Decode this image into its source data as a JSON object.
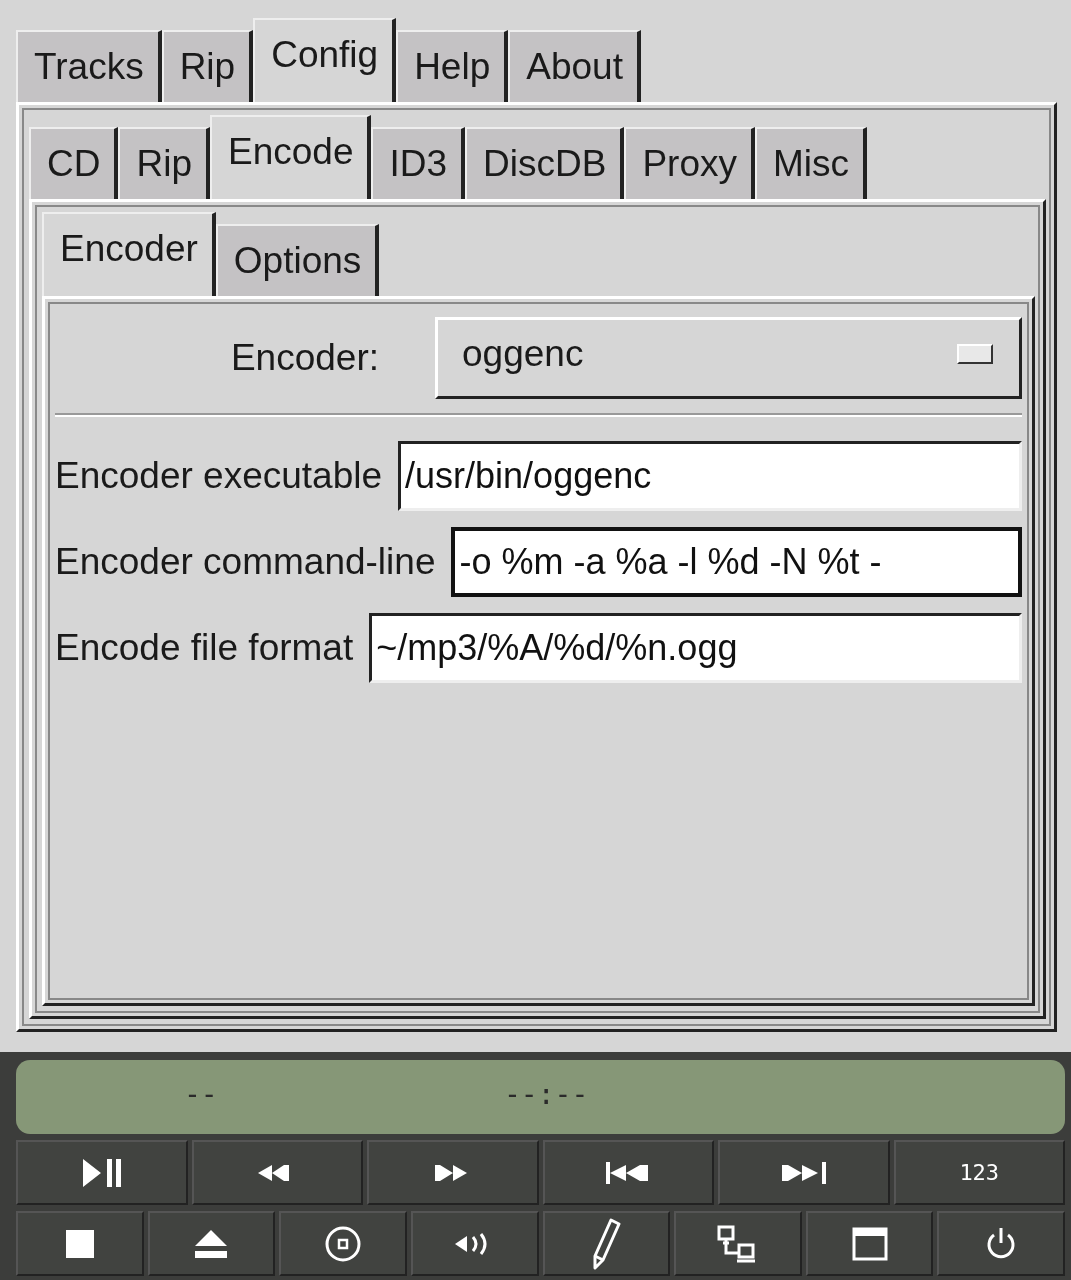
{
  "tabs": [
    {
      "label": "Tracks",
      "selected": false
    },
    {
      "label": "Rip",
      "selected": false
    },
    {
      "label": "Config",
      "selected": true
    },
    {
      "label": "Help",
      "selected": false
    },
    {
      "label": "About",
      "selected": false
    }
  ],
  "config_tabs": [
    {
      "label": "CD",
      "selected": false
    },
    {
      "label": "Rip",
      "selected": false
    },
    {
      "label": "Encode",
      "selected": true
    },
    {
      "label": "ID3",
      "selected": false
    },
    {
      "label": "DiscDB",
      "selected": false
    },
    {
      "label": "Proxy",
      "selected": false
    },
    {
      "label": "Misc",
      "selected": false
    }
  ],
  "encode_tabs": [
    {
      "label": "Encoder",
      "selected": true
    },
    {
      "label": "Options",
      "selected": false
    }
  ],
  "encoder": {
    "label": "Encoder:",
    "value": "oggenc"
  },
  "fields": [
    {
      "label": "Encoder executable",
      "value": "/usr/bin/oggenc",
      "focused": false
    },
    {
      "label": "Encoder command-line",
      "value": "-o %m -a %a -l %d -N %t -",
      "focused": true
    },
    {
      "label": "Encode file format",
      "value": "~/mp3/%A/%d/%n.ogg",
      "focused": false
    }
  ],
  "display": {
    "track": "--",
    "time": "--:--"
  },
  "number_button": "123"
}
